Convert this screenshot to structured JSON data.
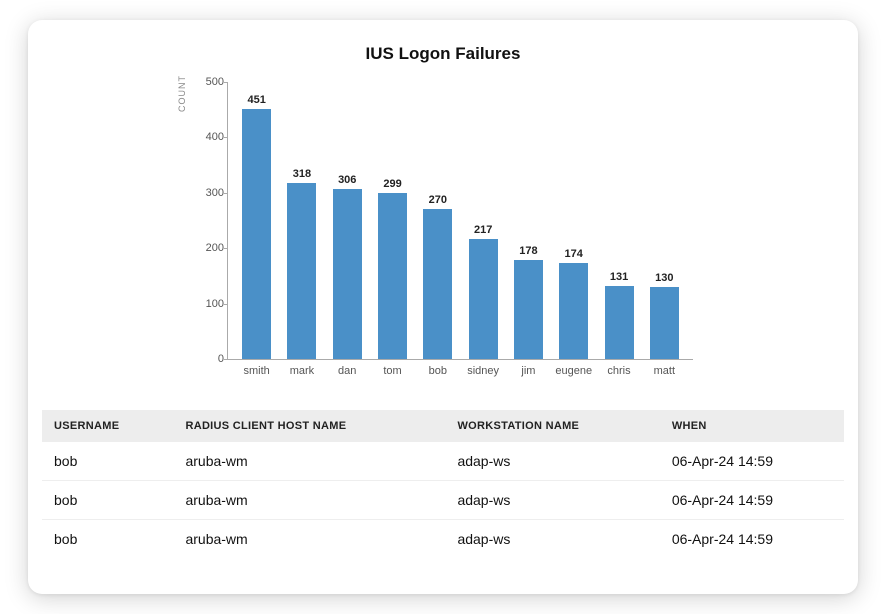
{
  "title": "IUS Logon Failures",
  "chart_data": {
    "type": "bar",
    "categories": [
      "smith",
      "mark",
      "dan",
      "tom",
      "bob",
      "sidney",
      "jim",
      "eugene",
      "chris",
      "matt"
    ],
    "values": [
      451,
      318,
      306,
      299,
      270,
      217,
      178,
      174,
      131,
      130
    ],
    "ylabel": "COUNT",
    "ylim": [
      0,
      500
    ],
    "yticks": [
      0,
      100,
      200,
      300,
      400,
      500
    ]
  },
  "table": {
    "columns": [
      "USERNAME",
      "RADIUS CLIENT HOST NAME",
      "WORKSTATION NAME",
      "WHEN"
    ],
    "rows": [
      {
        "username": "bob",
        "radius": "aruba-wm",
        "workstation": "adap-ws",
        "when": "06-Apr-24 14:59"
      },
      {
        "username": "bob",
        "radius": "aruba-wm",
        "workstation": "adap-ws",
        "when": "06-Apr-24 14:59"
      },
      {
        "username": "bob",
        "radius": "aruba-wm",
        "workstation": "adap-ws",
        "when": "06-Apr-24 14:59"
      }
    ]
  }
}
